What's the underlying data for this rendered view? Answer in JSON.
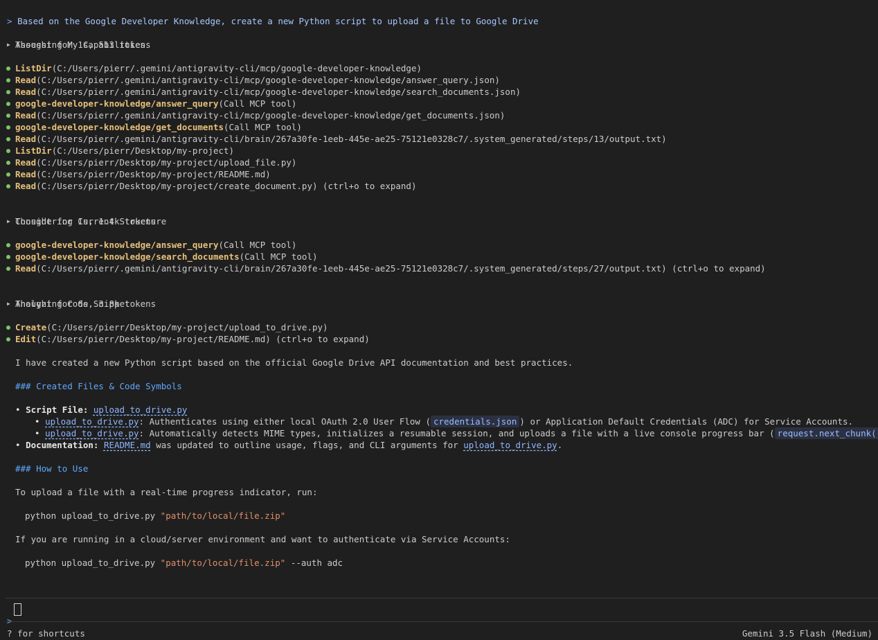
{
  "prompt": {
    "caret": ">",
    "text": "Based on the Google Developer Knowledge, create a new Python script to upload a file to Google Drive"
  },
  "thoughts": [
    {
      "header": "Thought for 1s, 513 tokens",
      "title": "Assessing My Capabilities"
    },
    {
      "header": "Thought for 1s, 1.4k tokens",
      "title": "Considering Current Structure"
    },
    {
      "header": "Thought for 6s, 3.8k tokens",
      "title": "Analyzing Code Snippet"
    }
  ],
  "tool_groups": [
    [
      {
        "name": "ListDir",
        "arg": "(C:/Users/pierr/.gemini/antigravity-cli/mcp/google-developer-knowledge)"
      },
      {
        "name": "Read",
        "arg": "(C:/Users/pierr/.gemini/antigravity-cli/mcp/google-developer-knowledge/answer_query.json)"
      },
      {
        "name": "Read",
        "arg": "(C:/Users/pierr/.gemini/antigravity-cli/mcp/google-developer-knowledge/search_documents.json)"
      },
      {
        "name": "google-developer-knowledge/answer_query",
        "arg": "(Call MCP tool)"
      },
      {
        "name": "Read",
        "arg": "(C:/Users/pierr/.gemini/antigravity-cli/mcp/google-developer-knowledge/get_documents.json)"
      },
      {
        "name": "google-developer-knowledge/get_documents",
        "arg": "(Call MCP tool)"
      },
      {
        "name": "Read",
        "arg": "(C:/Users/pierr/.gemini/antigravity-cli/brain/267a30fe-1eeb-445e-ae25-75121e0328c7/.system_generated/steps/13/output.txt)"
      },
      {
        "name": "ListDir",
        "arg": "(C:/Users/pierr/Desktop/my-project)"
      },
      {
        "name": "Read",
        "arg": "(C:/Users/pierr/Desktop/my-project/upload_file.py)"
      },
      {
        "name": "Read",
        "arg": "(C:/Users/pierr/Desktop/my-project/README.md)"
      },
      {
        "name": "Read",
        "arg": "(C:/Users/pierr/Desktop/my-project/create_document.py) (ctrl+o to expand)"
      }
    ],
    [
      {
        "name": "google-developer-knowledge/answer_query",
        "arg": "(Call MCP tool)"
      },
      {
        "name": "google-developer-knowledge/search_documents",
        "arg": "(Call MCP tool)"
      },
      {
        "name": "Read",
        "arg": "(C:/Users/pierr/.gemini/antigravity-cli/brain/267a30fe-1eeb-445e-ae25-75121e0328c7/.system_generated/steps/27/output.txt) (ctrl+o to expand)"
      }
    ],
    [
      {
        "name": "Create",
        "arg": "(C:/Users/pierr/Desktop/my-project/upload_to_drive.py)"
      },
      {
        "name": "Edit",
        "arg": "(C:/Users/pierr/Desktop/my-project/README.md) (ctrl+o to expand)"
      }
    ]
  ],
  "response": {
    "intro": "I have created a new Python script based on the official Google Drive API documentation and best practices.",
    "heading1": "### Created Files & Code Symbols",
    "script_file": {
      "bullet": "•",
      "label": "Script File:",
      "link": "upload_to_drive.py",
      "sub1": {
        "bullet": "•",
        "link": "upload_to_drive.py",
        "pre": ": Authenticates using either local OAuth 2.0 User Flow (",
        "code": "credentials.json",
        "post": ") or Application Default Credentials (ADC) for Service Accounts."
      },
      "sub2": {
        "bullet": "•",
        "link": "upload_to_drive.py",
        "pre": ": Automatically detects MIME types, initializes a resumable session, and uploads a file with a live console progress bar (",
        "code": "request.next_chunk()",
        "post": ")."
      }
    },
    "documentation": {
      "bullet": "•",
      "label": "Documentation:",
      "link1": "README.md",
      "mid": " was updated to outline usage, flags, and CLI arguments for ",
      "link2": "upload_to_drive.py",
      "end": "."
    },
    "heading2": "### How to Use",
    "usage1_text": "To upload a file with a real-time progress indicator, run:",
    "cmd1": {
      "cmd": "python upload_to_drive.py ",
      "arg": "\"path/to/local/file.zip\"",
      "rest": ""
    },
    "usage2_text": "If you are running in a cloud/server environment and want to authenticate via Service Accounts:",
    "cmd2": {
      "cmd": "python upload_to_drive.py ",
      "arg": "\"path/to/local/file.zip\"",
      "rest": " --auth adc"
    }
  },
  "input": {
    "caret": ">",
    "value": ""
  },
  "footer": {
    "left": "? for shortcuts",
    "right": "Gemini 3.5 Flash (Medium)"
  },
  "colors": {
    "background": "#1f1f1f",
    "tool_name": "#e5c07b",
    "success_dot": "#7ec36a",
    "heading": "#5fa8ff",
    "link": "#8fb6ff",
    "string": "#e0906a"
  }
}
